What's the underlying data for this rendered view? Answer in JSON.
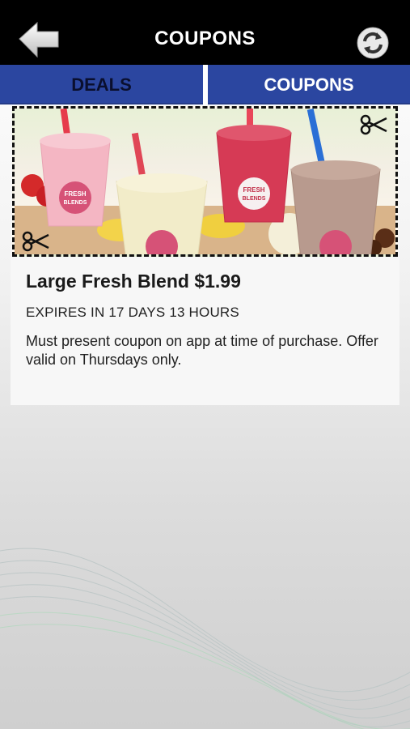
{
  "header": {
    "title": "COUPONS",
    "back_icon": "back-arrow-icon",
    "refresh_icon": "refresh-icon"
  },
  "tabs": [
    {
      "label": "DEALS",
      "active": false
    },
    {
      "label": "COUPONS",
      "active": true
    }
  ],
  "coupon": {
    "image_alt": "Fresh Blends smoothies",
    "cup_logo_text": "FRESH BLENDS",
    "title": "Large Fresh Blend $1.99",
    "expiry": "EXPIRES IN 17 DAYS 13 HOURS",
    "description": "Must present coupon on app at time of purchase. Offer valid on Thursdays only."
  },
  "colors": {
    "header_bg": "#000000",
    "tab_bg": "#2b46a0",
    "tab_active_text": "#ffffff",
    "tab_inactive_text": "#0a0f2e"
  }
}
